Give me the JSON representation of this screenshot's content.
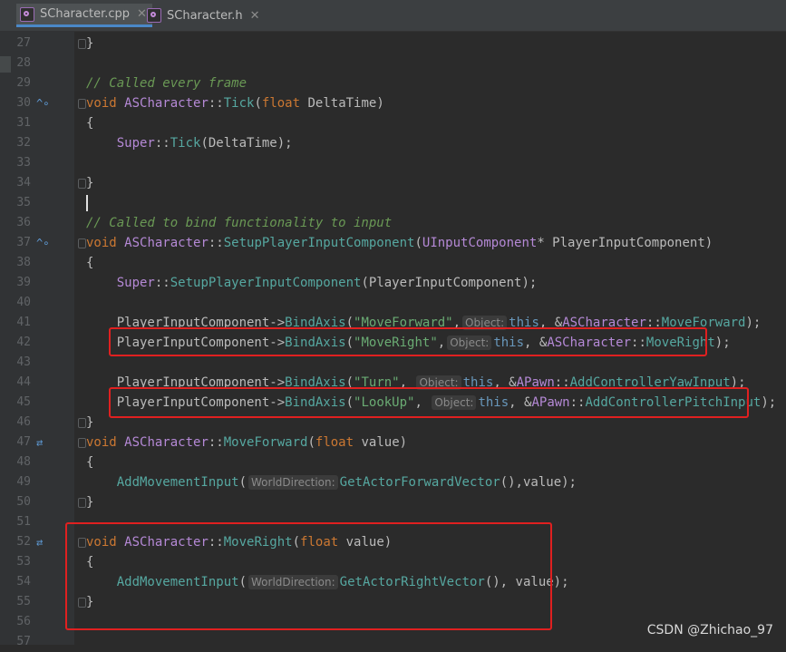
{
  "tabs": [
    {
      "label": "SCharacter.cpp",
      "active": true
    },
    {
      "label": "SCharacter.h",
      "active": false
    }
  ],
  "lines": [
    {
      "n": "27",
      "html": "}"
    },
    {
      "n": "28",
      "html": ""
    },
    {
      "n": "29",
      "html": "<span class=\"cmt\">// Called every frame</span>"
    },
    {
      "n": "30",
      "html": "<span class=\"fn\">void</span> <span class=\"cls\">ASCharacter</span>::<span class=\"mth\">Tick</span>(<span class=\"fn\">float</span> DeltaTime)"
    },
    {
      "n": "31",
      "html": "{"
    },
    {
      "n": "32",
      "html": "    <span class=\"cls\">Super</span>::<span class=\"mth\">Tick</span>(DeltaTime);"
    },
    {
      "n": "33",
      "html": ""
    },
    {
      "n": "34",
      "html": "}"
    },
    {
      "n": "35",
      "html": ""
    },
    {
      "n": "36",
      "html": "<span class=\"cmt\">// Called to bind functionality to input</span>"
    },
    {
      "n": "37",
      "html": "<span class=\"fn\">void</span> <span class=\"cls\">ASCharacter</span>::<span class=\"mth\">SetupPlayerInputComponent</span>(<span class=\"cls\">UInputComponent</span>* PlayerInputComponent)"
    },
    {
      "n": "38",
      "html": "{"
    },
    {
      "n": "39",
      "html": "    <span class=\"cls\">Super</span>::<span class=\"mth\">SetupPlayerInputComponent</span>(PlayerInputComponent);"
    },
    {
      "n": "40",
      "html": ""
    },
    {
      "n": "41",
      "html": "    PlayerInputComponent-><span class=\"mth\">BindAxis</span>(<span class=\"str\">\"MoveForward\"</span>,<span class=\"hint\">Object:</span><span class=\"kw\">this</span>, &amp;<span class=\"cls\">ASCharacter</span>::<span class=\"mth\">MoveForward</span>);"
    },
    {
      "n": "42",
      "html": "    PlayerInputComponent-><span class=\"mth\">BindAxis</span>(<span class=\"str\">\"MoveRight\"</span>,<span class=\"hint\">Object:</span><span class=\"kw\">this</span>, &amp;<span class=\"cls\">ASCharacter</span>::<span class=\"mth\">MoveRight</span>);"
    },
    {
      "n": "43",
      "html": ""
    },
    {
      "n": "44",
      "html": "    PlayerInputComponent-><span class=\"mth\">BindAxis</span>(<span class=\"str\">\"Turn\"</span>, <span class=\"hint\">Object:</span><span class=\"kw\">this</span>, &amp;<span class=\"cls\">APawn</span>::<span class=\"mth\">AddControllerYawInput</span>);"
    },
    {
      "n": "45",
      "html": "    PlayerInputComponent-><span class=\"mth\">BindAxis</span>(<span class=\"str\">\"LookUp\"</span>, <span class=\"hint\">Object:</span><span class=\"kw\">this</span>, &amp;<span class=\"cls\">APawn</span>::<span class=\"mth\">AddControllerPitchInput</span>);"
    },
    {
      "n": "46",
      "html": "}"
    },
    {
      "n": "47",
      "html": "<span class=\"fn\">void</span> <span class=\"cls\">ASCharacter</span>::<span class=\"mth\">MoveForward</span>(<span class=\"fn\">float</span> value)"
    },
    {
      "n": "48",
      "html": "{"
    },
    {
      "n": "49",
      "html": "    <span class=\"mth\">AddMovementInput</span>(<span class=\"hint\">WorldDirection:</span><span class=\"mth\">GetActorForwardVector</span>(),value);"
    },
    {
      "n": "50",
      "html": "}"
    },
    {
      "n": "51",
      "html": ""
    },
    {
      "n": "52",
      "html": "<span class=\"fn\">void</span> <span class=\"cls\">ASCharacter</span>::<span class=\"mth\">MoveRight</span>(<span class=\"fn\">float</span> value)"
    },
    {
      "n": "53",
      "html": "{"
    },
    {
      "n": "54",
      "html": "    <span class=\"mth\">AddMovementInput</span>(<span class=\"hint\">WorldDirection:</span><span class=\"mth\">GetActorRightVector</span>(), value);"
    },
    {
      "n": "55",
      "html": "}"
    },
    {
      "n": "56",
      "html": ""
    },
    {
      "n": "57",
      "html": ""
    }
  ],
  "gutter_icons": {
    "30": "override-icon",
    "37": "override-icon",
    "47": "bind-icon",
    "52": "bind-icon"
  },
  "watermark": "CSDN @Zhichao_97"
}
